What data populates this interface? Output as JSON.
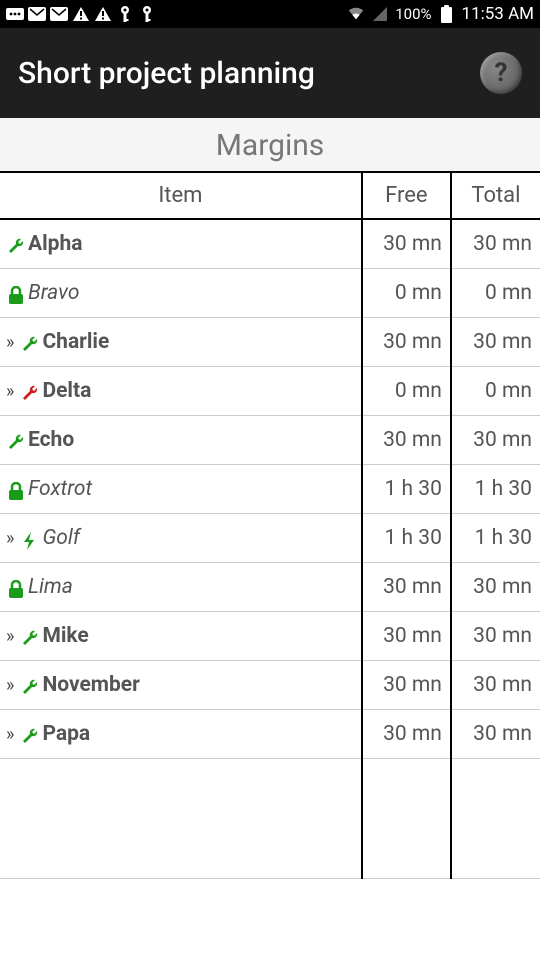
{
  "status_bar": {
    "battery_pct": "100%",
    "clock": "11:53 AM"
  },
  "app_bar": {
    "title": "Short project planning",
    "help": "?"
  },
  "section_title": "Margins",
  "table": {
    "headers": {
      "item": "Item",
      "free": "Free",
      "total": "Total"
    },
    "chevron": "»",
    "rows": [
      {
        "indent": false,
        "icon": "wrench-green",
        "name": "Alpha",
        "italic": false,
        "free": "30 mn",
        "total": "30 mn"
      },
      {
        "indent": false,
        "icon": "lock-green",
        "name": "Bravo",
        "italic": true,
        "free": "0 mn",
        "total": "0 mn"
      },
      {
        "indent": true,
        "icon": "wrench-green",
        "name": "Charlie",
        "italic": false,
        "free": "30 mn",
        "total": "30 mn"
      },
      {
        "indent": true,
        "icon": "wrench-red",
        "name": "Delta",
        "italic": false,
        "free": "0 mn",
        "total": "0 mn"
      },
      {
        "indent": false,
        "icon": "wrench-green",
        "name": "Echo",
        "italic": false,
        "free": "30 mn",
        "total": "30 mn"
      },
      {
        "indent": false,
        "icon": "lock-green",
        "name": "Foxtrot",
        "italic": true,
        "free": "1 h 30",
        "total": "1 h 30"
      },
      {
        "indent": true,
        "icon": "bolt-green",
        "name": "Golf",
        "italic": true,
        "free": "1 h 30",
        "total": "1 h 30"
      },
      {
        "indent": false,
        "icon": "lock-green",
        "name": "Lima",
        "italic": true,
        "free": "30 mn",
        "total": "30 mn"
      },
      {
        "indent": true,
        "icon": "wrench-green",
        "name": "Mike",
        "italic": false,
        "free": "30 mn",
        "total": "30 mn"
      },
      {
        "indent": true,
        "icon": "wrench-green",
        "name": "November",
        "italic": false,
        "free": "30 mn",
        "total": "30 mn"
      },
      {
        "indent": true,
        "icon": "wrench-green",
        "name": "Papa",
        "italic": false,
        "free": "30 mn",
        "total": "30 mn"
      }
    ]
  }
}
